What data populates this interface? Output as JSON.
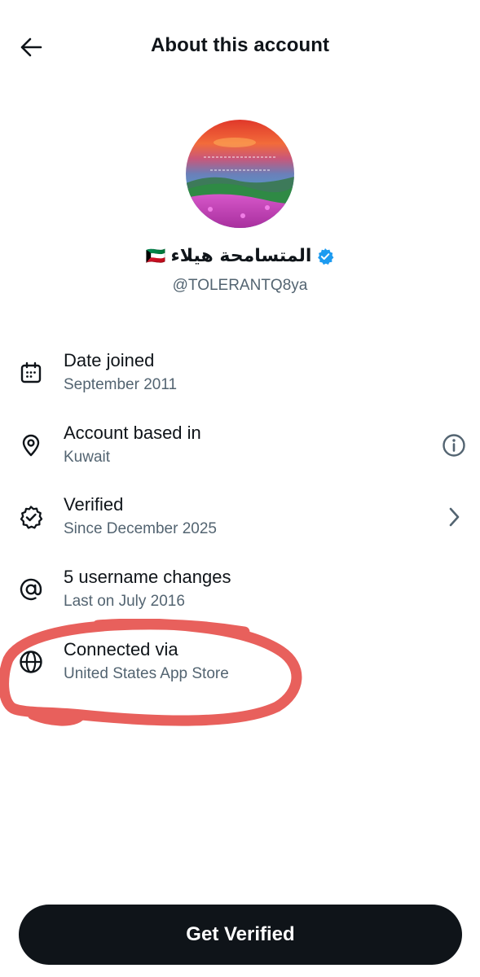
{
  "header": {
    "title": "About this account",
    "back_icon": "arrow-left-icon"
  },
  "profile": {
    "avatar_icon": "profile-avatar",
    "display_name": "المتسامحة هيلاء",
    "flag": "🇰🇼",
    "verified_badge_icon": "verified-badge-icon",
    "verified_color": "#1d9bf0",
    "handle": "@TOLERANTQ8ya"
  },
  "details": {
    "date_joined": {
      "icon": "calendar-icon",
      "title": "Date joined",
      "value": "September 2011"
    },
    "based_in": {
      "icon": "location-pin-icon",
      "title": "Account based in",
      "value": "Kuwait",
      "action_icon": "info-icon"
    },
    "verified": {
      "icon": "verified-outline-icon",
      "title": "Verified",
      "value": "Since December 2025",
      "action_icon": "chevron-right-icon"
    },
    "username_changes": {
      "icon": "at-sign-icon",
      "title": "5 username changes",
      "value": "Last on July 2016"
    },
    "connected_via": {
      "icon": "globe-icon",
      "title": "Connected via",
      "value": "United States App Store"
    }
  },
  "annotation": {
    "color": "#e8605c"
  },
  "cta": {
    "label": "Get Verified"
  },
  "colors": {
    "text_primary": "#0f1419",
    "text_secondary": "#536471",
    "button_bg": "#0f1419",
    "button_text": "#ffffff"
  }
}
